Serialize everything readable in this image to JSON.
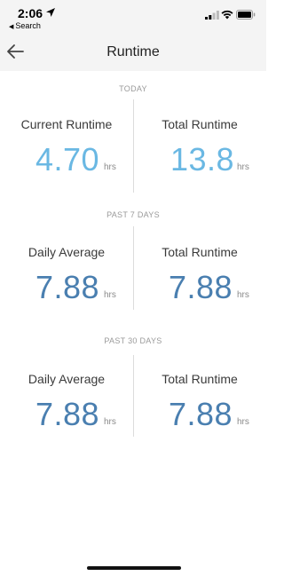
{
  "status_bar": {
    "time": "2:06",
    "back_app": "Search",
    "icons": [
      "location-arrow-icon",
      "cellular-signal-icon",
      "wifi-icon",
      "battery-icon"
    ]
  },
  "nav": {
    "title": "Runtime",
    "back_icon": "arrow-left-icon"
  },
  "sections": [
    {
      "label": "TODAY",
      "left": {
        "title": "Current Runtime",
        "value": "4.70",
        "unit": "hrs"
      },
      "right": {
        "title": "Total Runtime",
        "value": "13.8",
        "unit": "hrs"
      },
      "value_color": "#6ab8e3"
    },
    {
      "label": "PAST 7 DAYS",
      "left": {
        "title": "Daily Average",
        "value": "7.88",
        "unit": "hrs"
      },
      "right": {
        "title": "Total Runtime",
        "value": "7.88",
        "unit": "hrs"
      },
      "value_color": "#4a7fb0"
    },
    {
      "label": "PAST 30 DAYS",
      "left": {
        "title": "Daily Average",
        "value": "7.88",
        "unit": "hrs"
      },
      "right": {
        "title": "Total Runtime",
        "value": "7.88",
        "unit": "hrs"
      },
      "value_color": "#4a7fb0"
    }
  ]
}
